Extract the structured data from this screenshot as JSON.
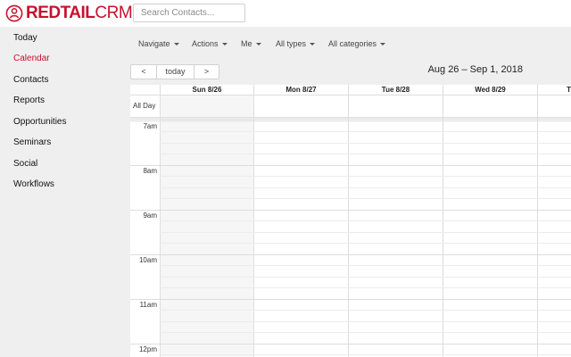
{
  "app": {
    "logo_bold": "REDTAIL",
    "logo_light": "CRM",
    "brand_color": "#c8102e",
    "logo_icon": "person-circle-icon"
  },
  "search": {
    "placeholder": "Search Contacts..."
  },
  "sidebar": {
    "items": [
      {
        "label": "Today"
      },
      {
        "label": "Calendar",
        "active": true
      },
      {
        "label": "Contacts"
      },
      {
        "label": "Reports"
      },
      {
        "label": "Opportunities"
      },
      {
        "label": "Seminars"
      },
      {
        "label": "Social"
      },
      {
        "label": "Workflows"
      }
    ]
  },
  "toolbar": {
    "menus": [
      {
        "label": "Navigate"
      },
      {
        "label": "Actions"
      },
      {
        "label": "Me"
      },
      {
        "label": "All types"
      },
      {
        "label": "All categories"
      }
    ],
    "prev_label": "<",
    "today_label": "today",
    "next_label": ">"
  },
  "calendar": {
    "range_title": "Aug 26 – Sep 1, 2018",
    "days": [
      "Sun 8/26",
      "Mon 8/27",
      "Tue 8/28",
      "Wed 8/29",
      "T"
    ],
    "all_day_label": "All Day",
    "hours": [
      "7am",
      "8am",
      "9am",
      "10am",
      "11am",
      "12pm"
    ]
  }
}
